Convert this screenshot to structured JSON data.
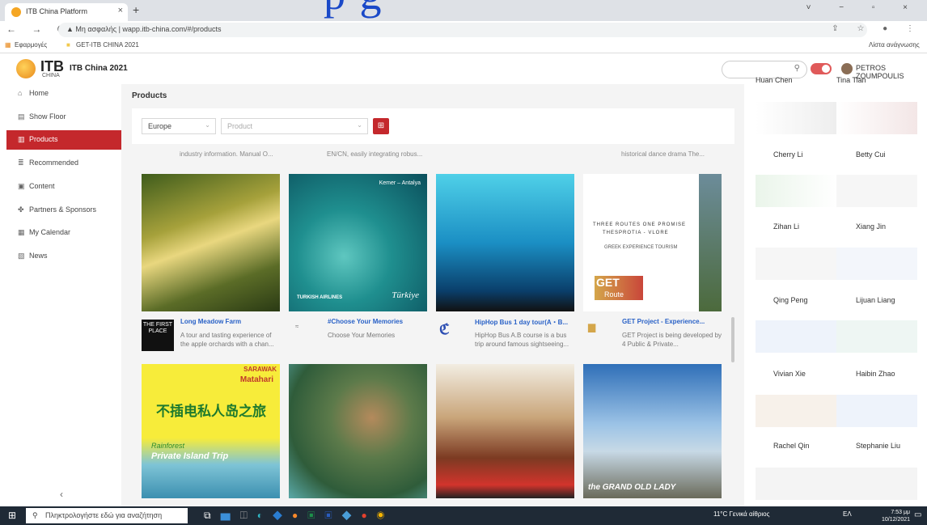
{
  "overlay_text": "p           g",
  "browser": {
    "tab_title": "ITB China Platform",
    "tab_close": "×",
    "new_tab": "+",
    "window_controls": "˅ − ▫ ×",
    "nav_buttons": "← → C",
    "security": "▲ Μη ασφαλής",
    "url": "wapp.itb-china.com/#/products",
    "omni_icons": "⇪ ☆ ● ⋮",
    "bookmarks": [
      "Εφαρμογές",
      "GET-ITB CHINA 2021"
    ],
    "reading_list": "Λίστα ανάγνωσης"
  },
  "header": {
    "logo_main": "ITB",
    "logo_sub": "CHINA",
    "title": "ITB China 2021",
    "search_icon": "search-icon",
    "user_name": "PETROS ZOUMPOULIS",
    "accent": "#c4282c"
  },
  "sidebar": {
    "items": [
      {
        "icon": "⌂",
        "label": "Home"
      },
      {
        "icon": "▤",
        "label": "Show Floor"
      },
      {
        "icon": "▥",
        "label": "Products"
      },
      {
        "icon": "≣",
        "label": "Recommended"
      },
      {
        "icon": "▣",
        "label": "Content"
      },
      {
        "icon": "✤",
        "label": "Partners & Sponsors"
      },
      {
        "icon": "▦",
        "label": "My Calendar"
      },
      {
        "icon": "▧",
        "label": "News"
      }
    ],
    "active_index": 2,
    "collapse": "‹"
  },
  "products": {
    "page_title": "Products",
    "region_value": "Europe",
    "product_placeholder": "Product",
    "cut_descriptions": [
      "industry information. Manual O...",
      "EN/CN, easily integrating robus...",
      "",
      "historical dance drama  The..."
    ],
    "row1": [
      {
        "title": "Long Meadow Farm",
        "desc": "A tour and tasting experience of the apple orchards with a chan...",
        "logo_text": "THE FIRST PLACE"
      },
      {
        "title": "#Choose Your Memories",
        "desc": "Choose Your Memories",
        "logo_text": ""
      },
      {
        "title": "HipHop Bus 1 day tour(A・B...",
        "desc": "HipHop Bus A.B course is a bus trip around famous sightseeing...",
        "logo_text": ""
      },
      {
        "title": "GET Project - Experience...",
        "desc": "GET Project is being developed by 4 Public & Private...",
        "logo_text": ""
      }
    ],
    "img_texts": {
      "turkey_location": "Kemer – Antalya",
      "turkish_airlines": "TURKISH AIRLINES",
      "turkiye": "Türkiye",
      "get_line1": "THREE ROUTES ONE PROMISE",
      "get_line2": "THESPROTIA - VLORE",
      "get_line3": "GREEK EXPERIENCE TOURISM",
      "get_logo": "GET",
      "get_route": "Route",
      "sarawak": "SARAWAK",
      "matahari": "Matahari",
      "rainforest": "Rainforest",
      "private_island": "Private Island Trip",
      "grand_old_lady": "the GRAND OLD LADY",
      "chinese_title": "不插电私人岛之旅"
    }
  },
  "people": [
    {
      "name": "Huan Chen"
    },
    {
      "name": "Tina Tian"
    },
    {
      "name": "Cherry Li"
    },
    {
      "name": "Betty Cui"
    },
    {
      "name": "Zihan Li"
    },
    {
      "name": "Xiang Jin"
    },
    {
      "name": "Qing Peng"
    },
    {
      "name": "Lijuan Liang"
    },
    {
      "name": "Vivian Xie"
    },
    {
      "name": "Haibin Zhao"
    },
    {
      "name": "Rachel Qin"
    },
    {
      "name": "Stephanie Liu"
    }
  ],
  "taskbar": {
    "search_placeholder": "Πληκτρολογήστε εδώ για αναζήτηση",
    "weather": "11°C Γενικά αίθριος",
    "lang": "ΕΛ",
    "time": "7:53 μμ",
    "date": "10/12/2021"
  }
}
